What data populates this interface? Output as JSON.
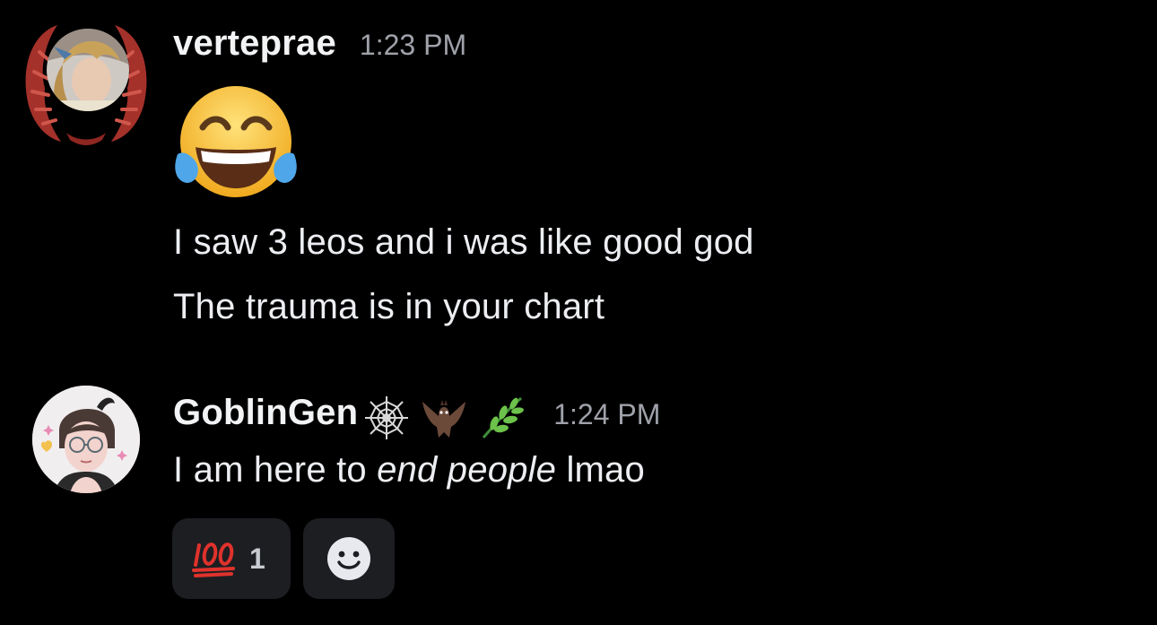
{
  "messages": [
    {
      "username": "verteprae",
      "timestamp": "1:23 PM",
      "big_emoji": "joy-face-emoji",
      "lines": [
        "I saw 3 leos and i was like good god",
        "The trauma is in your chart"
      ]
    },
    {
      "username": "GoblinGen",
      "name_emojis": [
        "spider-web-emoji",
        "bat-emoji",
        "herb-emoji"
      ],
      "timestamp": "1:24 PM",
      "text_before": "I am here to ",
      "text_italic": "end people",
      "text_after": " lmao",
      "reactions": [
        {
          "emoji": "hundred-points-emoji",
          "count": "1"
        }
      ],
      "add_reaction_icon": "smiley-add-reaction-icon"
    }
  ],
  "colors": {
    "background": "#000000",
    "username": "#f2f3f5",
    "timestamp": "#a0a2aa",
    "body_text": "#eceef2",
    "reaction_bg": "#1d1e22"
  }
}
